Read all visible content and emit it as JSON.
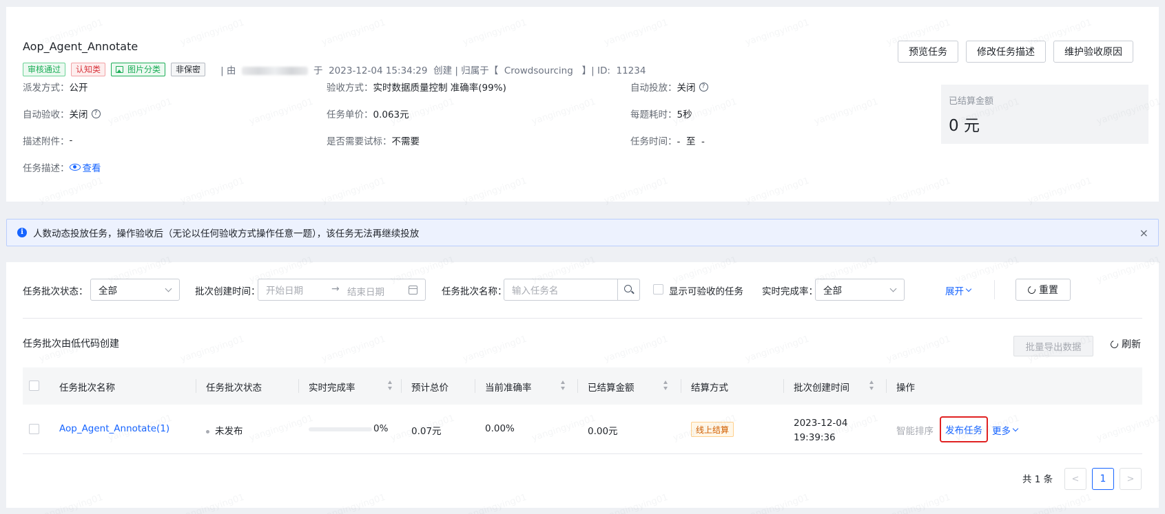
{
  "task": {
    "title": "Aop_Agent_Annotate",
    "tags": [
      "审核通过",
      "认知类",
      "图片分类",
      "非保密"
    ],
    "meta": {
      "by_prefix": "| 由",
      "by_suffix": "于",
      "created_at": "2023-12-04 15:34:29",
      "created_label": "创建 | 归属于【",
      "owner": "Crowdsourcing",
      "id_label": "】| ID:",
      "id": "11234"
    },
    "buttons": {
      "preview": "预览任务",
      "edit_desc": "修改任务描述",
      "maintain_reason": "维护验收原因"
    },
    "info": {
      "dispatch_label": "派发方式：",
      "dispatch_value": "公开",
      "accept_method_label": "验收方式：",
      "accept_method_value": "实时数据质量控制 准确率(99%)",
      "auto_release_label": "自动投放：",
      "auto_release_value": "关闭",
      "auto_accept_label": "自动验收：",
      "auto_accept_value": "关闭",
      "unit_price_label": "任务单价：",
      "unit_price_value": "0.063元",
      "time_per_q_label": "每题耗时：",
      "time_per_q_value": "5秒",
      "attachment_label": "描述附件：",
      "attachment_value": "-",
      "trial_label": "是否需要试标：",
      "trial_value": "不需要",
      "task_time_label": "任务时间：",
      "task_time_value": "-  至  -",
      "desc_label": "任务描述：",
      "desc_link": "查看"
    },
    "settled": {
      "label": "已结算金额",
      "value": "0 元"
    }
  },
  "alert": {
    "text": "人数动态投放任务，操作验收后（无论以任何验收方式操作任意一题），该任务无法再继续投放",
    "close": "×"
  },
  "filters": {
    "batch_status_label": "任务批次状态：",
    "batch_status_value": "全部",
    "created_time_label": "批次创建时间：",
    "start_placeholder": "开始日期",
    "end_placeholder": "结束日期",
    "range_arrow": "→",
    "batch_name_label": "任务批次名称：",
    "batch_name_placeholder": "输入任务名",
    "show_acceptable_label": "显示可验收的任务",
    "completion_label": "实时完成率：",
    "completion_value": "全部",
    "expand": "展开",
    "reset": "重置"
  },
  "batches": {
    "subtitle": "任务批次由低代码创建",
    "export": "批量导出数据",
    "refresh": "刷新",
    "columns": [
      "任务批次名称",
      "任务批次状态",
      "实时完成率",
      "预计总价",
      "当前准确率",
      "已结算金额",
      "结算方式",
      "批次创建时间",
      "操作"
    ],
    "rows": [
      {
        "name": "Aop_Agent_Annotate(1)",
        "status": "未发布",
        "completion": "0%",
        "completion_fraction": 0,
        "total_price": "0.07元",
        "accuracy": "0.00%",
        "settled": "0.00元",
        "settle_method": "线上结算",
        "created_date": "2023-12-04",
        "created_time": "19:39:36",
        "op_sort": "智能排序",
        "op_publish": "发布任务",
        "op_more": "更多"
      }
    ]
  },
  "pagination": {
    "total": "共 1 条",
    "current": "1",
    "prev": "<",
    "next": ">"
  },
  "watermark": "yangingying01",
  "colors": {
    "primary": "#1664ff",
    "highlight_border": "#e02020"
  }
}
